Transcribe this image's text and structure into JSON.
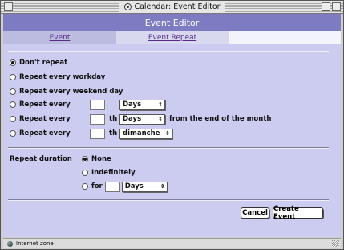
{
  "window": {
    "title": "Calendar: Event Editor"
  },
  "page_title": "Event Editor",
  "tabs": [
    {
      "label": "Event"
    },
    {
      "label": "Event Repeat"
    }
  ],
  "repeat": {
    "dont": "Don't repeat",
    "workday": "Repeat every workday",
    "weekend": "Repeat every weekend day",
    "every1": "Repeat every",
    "every1_unit": "Days",
    "every2": "Repeat every",
    "every2_th": "th",
    "every2_unit": "Days",
    "every2_suffix": "from the end of the month",
    "every3": "Repeat every",
    "every3_th": "th",
    "every3_day": "dimanche"
  },
  "duration": {
    "label": "Repeat duration",
    "none": "None",
    "indef": "Indefinitely",
    "for": "for",
    "for_unit": "Days"
  },
  "buttons": {
    "cancel": "Cancel",
    "create": "Create Event"
  },
  "status": {
    "zone": "Internet zone"
  },
  "colors": {
    "header": "#7d7cc3",
    "content_bg": "#ccccf0",
    "tab_link": "#5a2a8a"
  }
}
